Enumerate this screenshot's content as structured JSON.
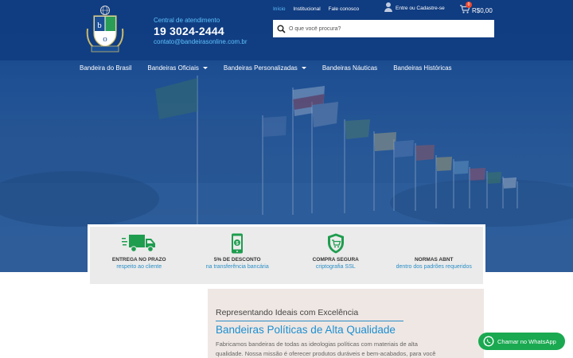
{
  "header": {
    "contact_label": "Central de atendimento",
    "phone": "19 3024-2444",
    "email": "contato@bandeirasonline.com.br",
    "logo_text": "Bandeiras"
  },
  "top_links": [
    "Início",
    "Institucional",
    "Fale conosco"
  ],
  "account": {
    "label": "Entre ou Cadastre-se"
  },
  "cart": {
    "count": "0",
    "total": "R$0,00"
  },
  "search": {
    "placeholder": "O que você procura?"
  },
  "nav": [
    {
      "label": "Bandeira do Brasil",
      "dropdown": false
    },
    {
      "label": "Bandeiras Oficiais",
      "dropdown": true
    },
    {
      "label": "Bandeiras Personalizadas",
      "dropdown": true
    },
    {
      "label": "Bandeiras Náuticas",
      "dropdown": false
    },
    {
      "label": "Bandeiras Históricas",
      "dropdown": false
    }
  ],
  "features": [
    {
      "icon": "truck-icon",
      "title": "ENTREGA NO PRAZO",
      "subtitle": "respeito ao cliente"
    },
    {
      "icon": "phone-money-icon",
      "title": "5% DE DESCONTO",
      "subtitle": "na transferência bancária"
    },
    {
      "icon": "shield-cart-icon",
      "title": "COMPRA SEGURA",
      "subtitle": "criptografia SSL"
    },
    {
      "icon": "none",
      "title": "NORMAS ABNT",
      "subtitle": "dentro dos padrões requeridos"
    }
  ],
  "content": {
    "kicker": "Representando Ideais com Excelência",
    "heading": "Bandeiras Políticas de Alta Qualidade",
    "paragraph_line1": "Fabricamos bandeiras de todas as ideologias políticas com materiais de alta",
    "paragraph_line2": "qualidade. Nossa missão é oferecer produtos duráveis e bem-acabados, para você"
  },
  "whatsapp": {
    "label": "Chamar no WhatsApp"
  },
  "colors": {
    "header_blue": "#0f3b7f",
    "accent_blue": "#1c8fd1",
    "light_blue": "#5fc3ff",
    "whatsapp_green": "#1aa951",
    "feature_green": "#1e9d4f",
    "badge_red": "#e8492f"
  }
}
